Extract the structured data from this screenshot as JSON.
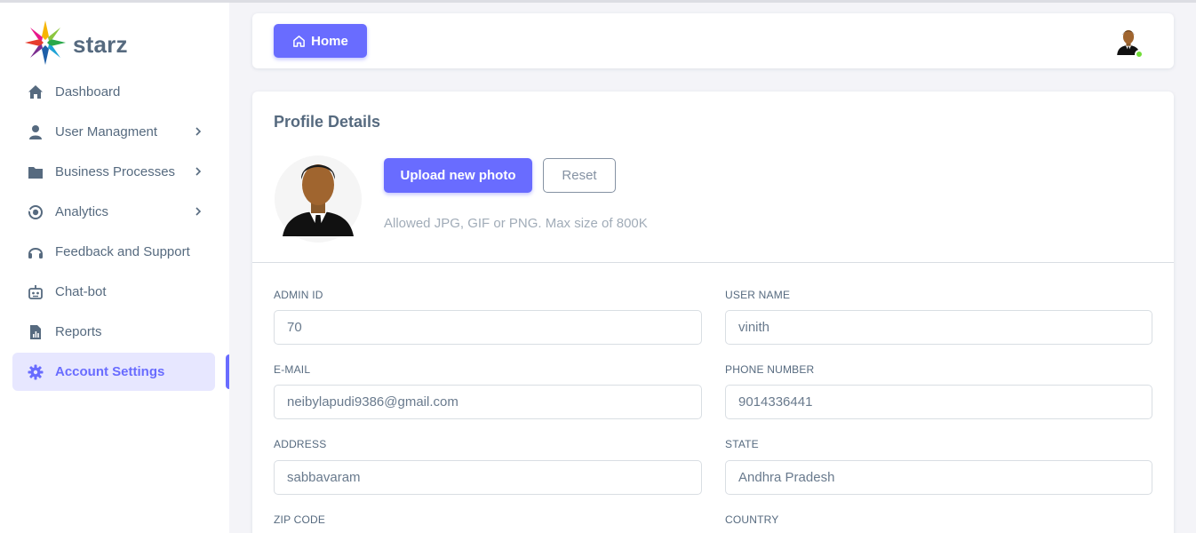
{
  "brand": {
    "name": "starz"
  },
  "sidebar": {
    "items": [
      {
        "label": "Dashboard",
        "icon": "home-icon",
        "has_submenu": false,
        "active": false
      },
      {
        "label": "User Managment",
        "icon": "user-icon",
        "has_submenu": true,
        "active": false
      },
      {
        "label": "Business Processes",
        "icon": "folder-icon",
        "has_submenu": true,
        "active": false
      },
      {
        "label": "Analytics",
        "icon": "analytics-icon",
        "has_submenu": true,
        "active": false
      },
      {
        "label": "Feedback and Support",
        "icon": "headset-icon",
        "has_submenu": false,
        "active": false
      },
      {
        "label": "Chat-bot",
        "icon": "robot-icon",
        "has_submenu": false,
        "active": false
      },
      {
        "label": "Reports",
        "icon": "report-icon",
        "has_submenu": false,
        "active": false
      },
      {
        "label": "Account Settings",
        "icon": "gear-icon",
        "has_submenu": false,
        "active": true
      }
    ]
  },
  "navbar": {
    "home_label": "Home",
    "user_status": "online"
  },
  "profile": {
    "title": "Profile Details",
    "upload_label": "Upload new photo",
    "reset_label": "Reset",
    "hint": "Allowed JPG, GIF or PNG. Max size of 800K"
  },
  "form": {
    "admin_id": {
      "label": "ADMIN ID",
      "value": "70"
    },
    "user_name": {
      "label": "USER NAME",
      "value": "vinith"
    },
    "email": {
      "label": "E-MAIL",
      "value": "neibylapudi9386@gmail.com"
    },
    "phone": {
      "label": "PHONE NUMBER",
      "value": "9014336441"
    },
    "address": {
      "label": "ADDRESS",
      "value": "sabbavaram"
    },
    "state": {
      "label": "STATE",
      "value": "Andhra Pradesh"
    },
    "zip": {
      "label": "ZIP CODE",
      "value": ""
    },
    "country": {
      "label": "COUNTRY",
      "value": ""
    }
  },
  "colors": {
    "primary": "#696cff",
    "text": "#566a7f",
    "muted": "#a1acb8",
    "online": "#71dd37"
  }
}
